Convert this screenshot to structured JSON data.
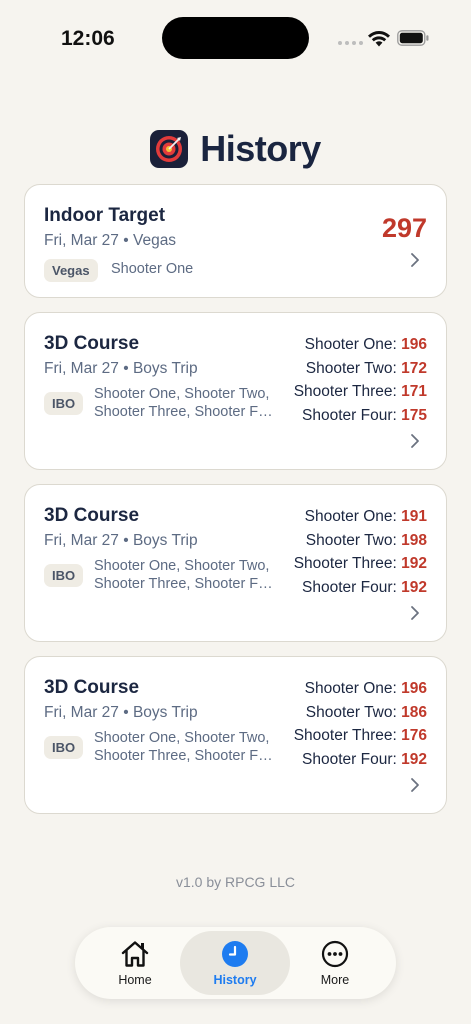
{
  "status_bar": {
    "time": "12:06"
  },
  "header": {
    "title": "History"
  },
  "cards": [
    {
      "title": "Indoor Target",
      "subtitle": "Fri, Mar 27 • Vegas",
      "badge": "Vegas",
      "shooters_line": "Shooter One",
      "total_score": "297"
    },
    {
      "title": "3D Course",
      "subtitle": "Fri, Mar 27 • Boys Trip",
      "badge": "IBO",
      "shooters_line1": "Shooter One, Shooter Two,",
      "shooters_line2": "Shooter Three, Shooter Four",
      "scores": [
        {
          "name": "Shooter One:",
          "value": "196"
        },
        {
          "name": "Shooter Two:",
          "value": "172"
        },
        {
          "name": "Shooter Three:",
          "value": "171"
        },
        {
          "name": "Shooter Four:",
          "value": "175"
        }
      ]
    },
    {
      "title": "3D Course",
      "subtitle": "Fri, Mar 27 • Boys Trip",
      "badge": "IBO",
      "shooters_line1": "Shooter One, Shooter Two,",
      "shooters_line2": "Shooter Three, Shooter Four",
      "scores": [
        {
          "name": "Shooter One:",
          "value": "191"
        },
        {
          "name": "Shooter Two:",
          "value": "198"
        },
        {
          "name": "Shooter Three:",
          "value": "192"
        },
        {
          "name": "Shooter Four:",
          "value": "192"
        }
      ]
    },
    {
      "title": "3D Course",
      "subtitle": "Fri, Mar 27 • Boys Trip",
      "badge": "IBO",
      "shooters_line1": "Shooter One, Shooter Two,",
      "shooters_line2": "Shooter Three, Shooter Four",
      "scores": [
        {
          "name": "Shooter One:",
          "value": "196"
        },
        {
          "name": "Shooter Two:",
          "value": "186"
        },
        {
          "name": "Shooter Three:",
          "value": "176"
        },
        {
          "name": "Shooter Four:",
          "value": "192"
        }
      ]
    }
  ],
  "footer": {
    "version": "v1.0 by RPCG LLC"
  },
  "tab_bar": {
    "home_label": "Home",
    "history_label": "History",
    "more_label": "More",
    "active": "History"
  },
  "colors": {
    "background": "#f6f4ef",
    "score_red": "#c0392b",
    "accent_blue": "#1e7cf0",
    "title_navy": "#1a2540"
  },
  "icons": {
    "app": "archery-target-icon",
    "home": "house-icon",
    "history": "clock-icon",
    "more": "ellipsis-circle-icon",
    "chevron": "chevron-right-icon"
  }
}
